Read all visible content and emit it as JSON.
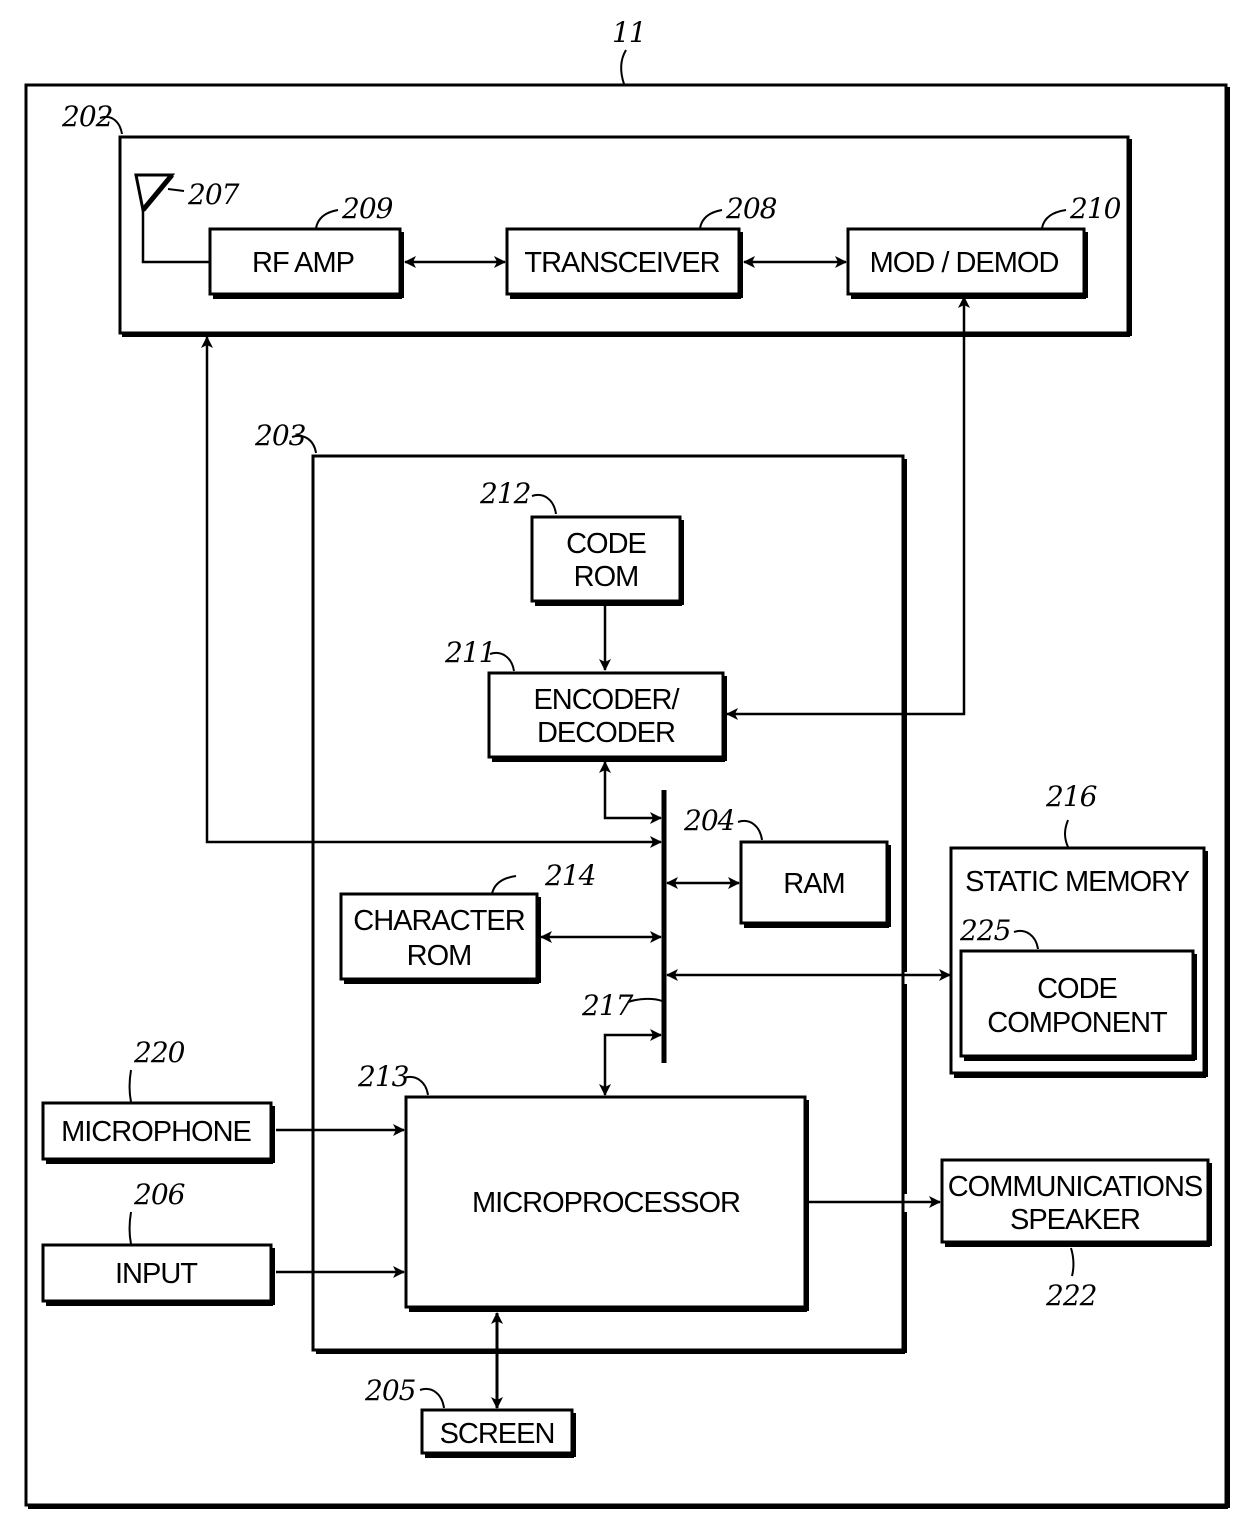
{
  "figure": {
    "device_ref": "11",
    "colors": {
      "ink": "#000000",
      "paper": "#ffffff"
    }
  },
  "blocks": {
    "rf_section": {
      "ref": "202"
    },
    "antenna": {
      "ref": "207"
    },
    "rf_amp": {
      "ref": "209",
      "lines": [
        "RF AMP"
      ]
    },
    "transceiver": {
      "ref": "208",
      "lines": [
        "TRANSCEIVER"
      ]
    },
    "mod_demod": {
      "ref": "210",
      "lines": [
        "MOD / DEMOD"
      ]
    },
    "controller": {
      "ref": "203"
    },
    "code_rom": {
      "ref": "212",
      "lines": [
        "CODE",
        "ROM"
      ]
    },
    "encoder_decoder": {
      "ref": "211",
      "lines": [
        "ENCODER/",
        "DECODER"
      ]
    },
    "ram": {
      "ref": "204",
      "lines": [
        "RAM"
      ]
    },
    "character_rom": {
      "ref": "214",
      "lines": [
        "CHARACTER",
        "ROM"
      ]
    },
    "bus": {
      "ref": "217"
    },
    "static_memory": {
      "ref": "216",
      "lines": [
        "STATIC MEMORY"
      ]
    },
    "code_component": {
      "ref": "225",
      "lines": [
        "CODE",
        "COMPONENT"
      ]
    },
    "microprocessor": {
      "ref": "213",
      "lines": [
        "MICROPROCESSOR"
      ]
    },
    "microphone": {
      "ref": "220",
      "lines": [
        "MICROPHONE"
      ]
    },
    "input": {
      "ref": "206",
      "lines": [
        "INPUT"
      ]
    },
    "speaker": {
      "ref": "222",
      "lines": [
        "COMMUNICATIONS",
        "SPEAKER"
      ]
    },
    "screen": {
      "ref": "205",
      "lines": [
        "SCREEN"
      ]
    }
  }
}
